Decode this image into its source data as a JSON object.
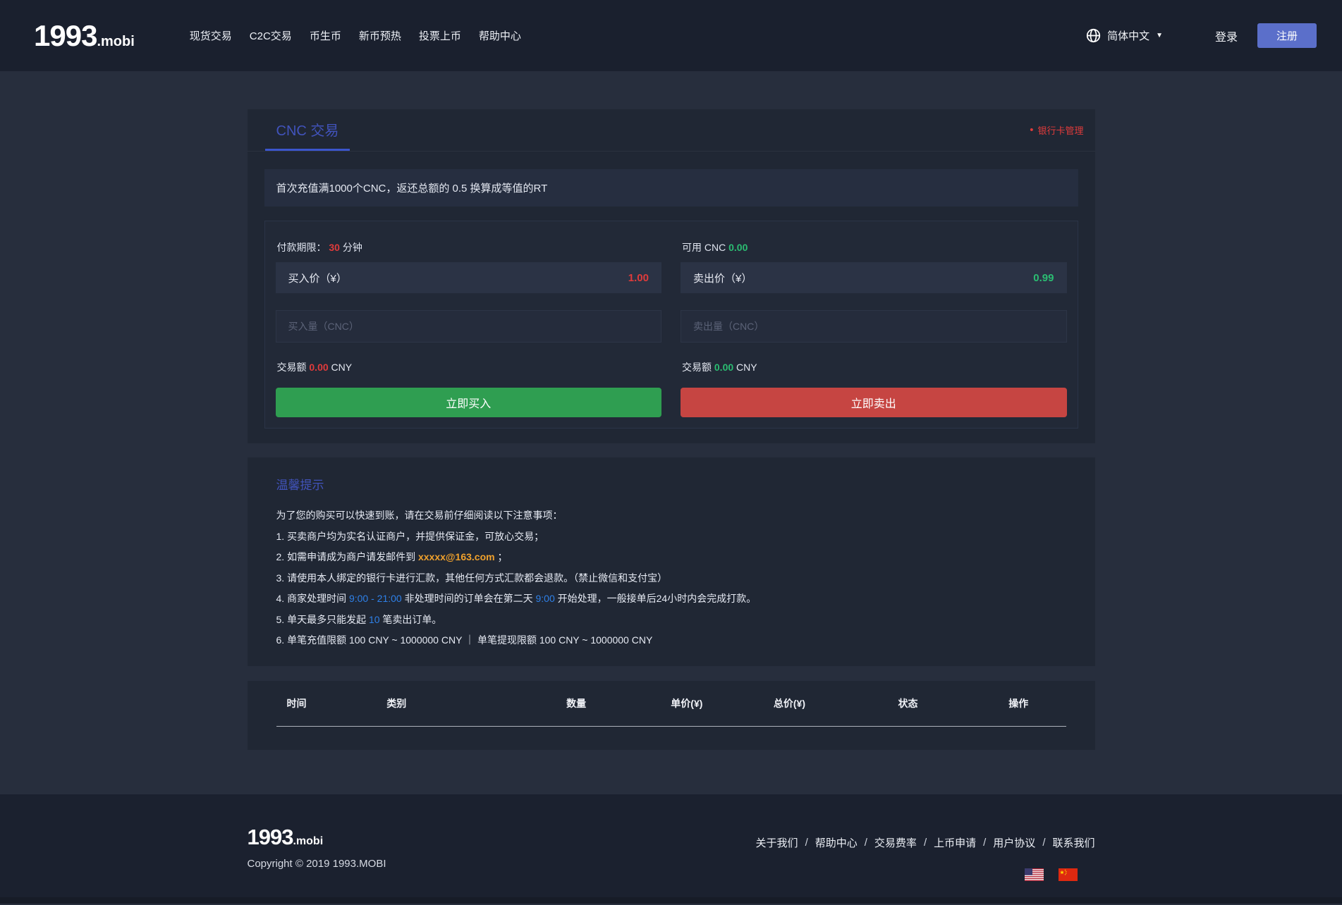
{
  "colors": {
    "navbar_bg": "#1a202e",
    "page_bg": "#272e3d",
    "card_bg": "#202734",
    "accent_blue": "#4153bb",
    "tab_underline": "#3b55cc",
    "red": "#e03b3b",
    "green": "#2bbd72",
    "orange": "#f0a12c",
    "link_blue": "#2e80e8",
    "register_button": "#5b6fca",
    "buy_button": "#2f9e51",
    "sell_button": "#c64542"
  },
  "brand": {
    "name_big": "1993",
    "name_small": ".mobi"
  },
  "navbar": {
    "items": [
      "现货交易",
      "C2C交易",
      "币生币",
      "新币预热",
      "投票上币",
      "帮助中心"
    ],
    "language": "简体中文",
    "caret": "▼",
    "login": "登录",
    "register": "注册"
  },
  "trade_card": {
    "tab_title": "CNC 交易",
    "bank_bullet": "•",
    "bank_link": "银行卡管理",
    "notice": "首次充值满1000个CNC，返还总额的 0.5 换算成等值的RT",
    "buy": {
      "deadline_label": "付款期限：",
      "deadline_value": "30",
      "deadline_unit": "分钟",
      "price_label": "买入价（¥）",
      "price_value": "1.00",
      "amount_placeholder": "买入量（CNC）",
      "total_label": "交易额",
      "total_value": "0.00",
      "total_unit": "CNY",
      "button": "立即买入"
    },
    "sell": {
      "available_label": "可用 CNC",
      "available_value": "0.00",
      "price_label": "卖出价（¥）",
      "price_value": "0.99",
      "amount_placeholder": "卖出量（CNC）",
      "total_label": "交易额",
      "total_value": "0.00",
      "total_unit": "CNY",
      "button": "立即卖出"
    }
  },
  "tips_card": {
    "title": "温馨提示",
    "intro": "为了您的购买可以快速到账，请在交易前仔细阅读以下注意事项：",
    "line1": "1. 买卖商户均为实名认证商户，并提供保证金，可放心交易；",
    "line2_prefix": "2. 如需申请成为商户请发邮件到 ",
    "line2_email": "xxxxx@163.com",
    "line2_suffix": " ；",
    "line3": "3. 请使用本人绑定的银行卡进行汇款，其他任何方式汇款都会退款。（禁止微信和支付宝）",
    "line4_part1": "4. 商家处理时间 ",
    "line4_time1": "9:00 - 21:00",
    "line4_part2": " 非处理时间的订单会在第二天 ",
    "line4_time2": "9:00",
    "line4_part3": " 开始处理，一般接单后24小时内会完成打款。",
    "line5_part1": "5. 单天最多只能发起 ",
    "line5_count": "10",
    "line5_part2": " 笔卖出订单。",
    "line6": "6. 单笔充值限额 100 CNY ~ 1000000 CNY ｜ 单笔提现限额 100 CNY ~ 1000000 CNY"
  },
  "orders_table": {
    "columns": [
      "时间",
      "类别",
      "数量",
      "单价(¥)",
      "总价(¥)",
      "状态",
      "操作"
    ]
  },
  "footer": {
    "links": [
      "关于我们",
      "帮助中心",
      "交易费率",
      "上币申请",
      "用户协议",
      "联系我们"
    ],
    "separator": "/",
    "copyright": "Copyright © 2019 1993.MOBI",
    "flag_icons": [
      "us-flag-icon",
      "cn-flag-icon"
    ]
  }
}
